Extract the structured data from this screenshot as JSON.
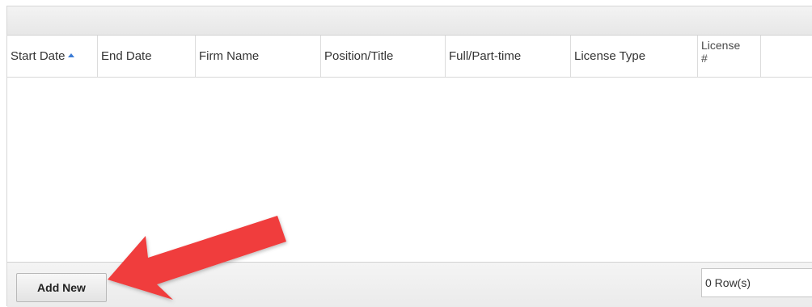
{
  "columns": [
    {
      "label": "Start Date",
      "sort": "ascending"
    },
    {
      "label": "End Date"
    },
    {
      "label": "Firm Name"
    },
    {
      "label": "Position/Title"
    },
    {
      "label": "Full/Part-time"
    },
    {
      "label": "License Type"
    },
    {
      "label": "License #"
    }
  ],
  "rows": [],
  "footer": {
    "add_button_label": "Add New",
    "row_count_label": "0 Row(s)"
  },
  "annotation": {
    "arrow_color": "#f03c3c",
    "arrow_target": "add-new-button"
  }
}
